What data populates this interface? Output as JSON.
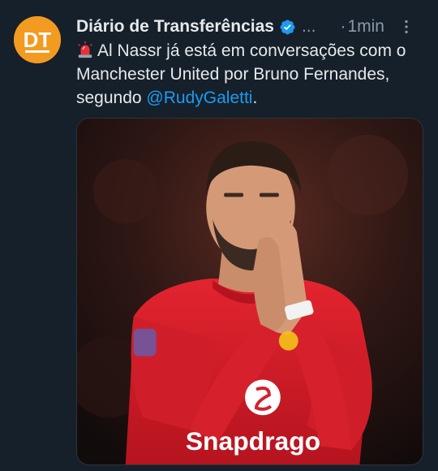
{
  "tweet": {
    "author_name": "Diário de Transferências",
    "handle": "...",
    "time_sep": "·",
    "time": "1min",
    "avatar_text": "DT",
    "text_main": "Al Nassr já está em conversações com o Manchester United por Bruno Fernandes, segundo ",
    "mention": "@RudyGaletti",
    "text_end": ".",
    "image": {
      "shirt_sponsor": "Snapdrago",
      "alt": "Bruno Fernandes applauding in red Manchester United shirt"
    }
  },
  "icons": {
    "verified": "verified-badge-icon",
    "more": "more-options-icon",
    "siren": "siren-emoji-icon"
  },
  "colors": {
    "background": "#15202b",
    "text": "#e7e9ea",
    "muted": "#8b98a5",
    "link": "#1d9bf0",
    "avatar": "#f39a21",
    "shirt": "#d6202b"
  }
}
